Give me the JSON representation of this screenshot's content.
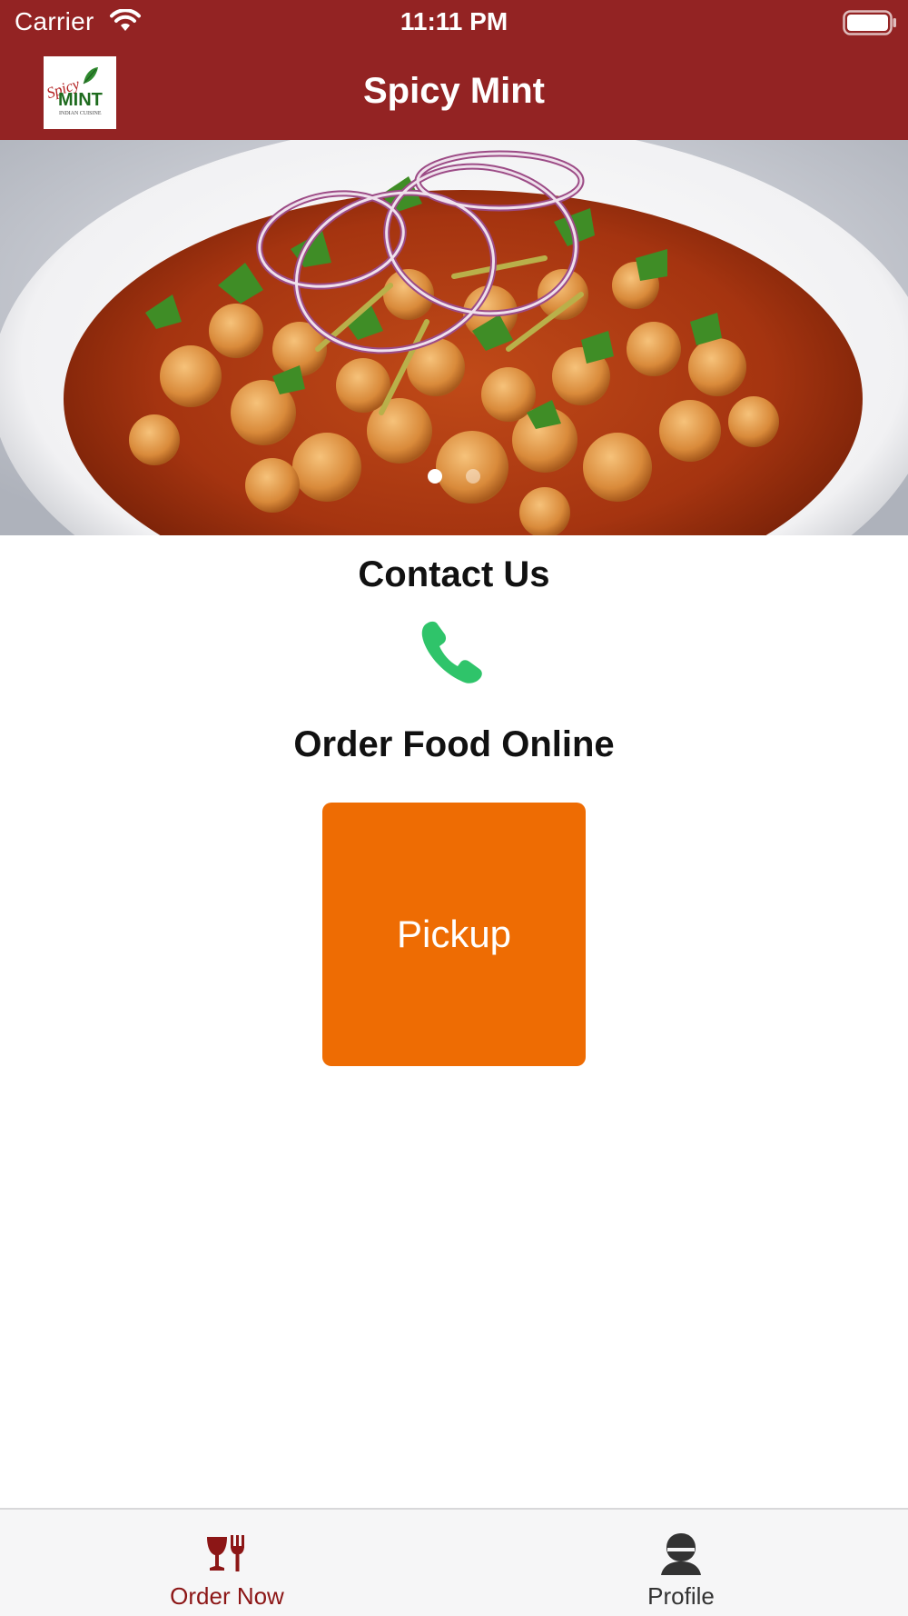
{
  "status_bar": {
    "carrier": "Carrier",
    "time": "11:11 PM"
  },
  "nav": {
    "title": "Spicy Mint"
  },
  "logo": {
    "script_text": "Spicy",
    "word": "MINT",
    "tagline": "INDIAN CUISINE"
  },
  "carousel": {
    "page_count": 2,
    "active_index": 0
  },
  "contact": {
    "title": "Contact Us"
  },
  "order": {
    "title": "Order Food Online",
    "pickup_label": "Pickup"
  },
  "tabs": [
    {
      "label": "Order Now",
      "icon": "wine-fork-icon",
      "selected": true
    },
    {
      "label": "Profile",
      "icon": "person-icon",
      "selected": false
    }
  ],
  "colors": {
    "brand": "#932323",
    "accent_orange": "#EE6C03",
    "phone_green": "#2FC46A",
    "tab_selected": "#8C1616"
  }
}
